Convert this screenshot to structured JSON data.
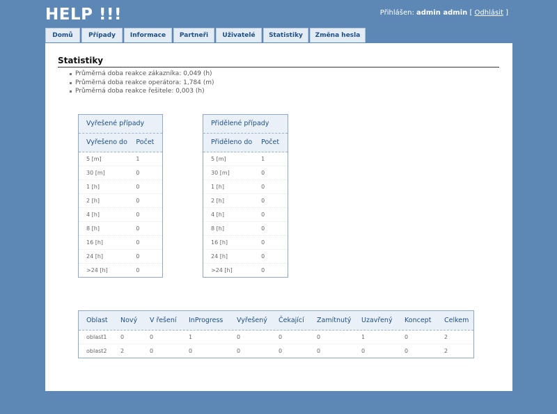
{
  "app": {
    "title": "HELP !!!"
  },
  "user": {
    "prefix": "Přihlášen:",
    "name": "admin admin",
    "open_bracket": "[",
    "logout": "Odhlásit",
    "close_bracket": "]"
  },
  "tabs": [
    "Domů",
    "Případy",
    "Informace",
    "Partneři",
    "Uživatelé",
    "Statistiky",
    "Změna hesla"
  ],
  "page": {
    "heading": "Statistiky"
  },
  "averages": [
    "Průměrná doba reakce zákazníka: 0,049 (h)",
    "Průměrná doba reakce operátora: 1,784 (m)",
    "Průměrná doba reakce řešitele: 0,003 (h)"
  ],
  "resolved": {
    "title": "Vyřešené případy",
    "headers": [
      "Vyřešeno do",
      "Počet"
    ],
    "rows": [
      [
        "5 [m]",
        "1"
      ],
      [
        "30 [m]",
        "0"
      ],
      [
        "1 [h]",
        "0"
      ],
      [
        "2 [h]",
        "0"
      ],
      [
        "4 [h]",
        "0"
      ],
      [
        "8 [h]",
        "0"
      ],
      [
        "16 [h]",
        "0"
      ],
      [
        "24 [h]",
        "0"
      ],
      [
        ">24 [h]",
        "0"
      ]
    ]
  },
  "assigned": {
    "title": "Přidělené případy",
    "headers": [
      "Přiděleno do",
      "Počet"
    ],
    "rows": [
      [
        "5 [m]",
        "1"
      ],
      [
        "30 [m]",
        "0"
      ],
      [
        "1 [h]",
        "0"
      ],
      [
        "2 [h]",
        "0"
      ],
      [
        "4 [h]",
        "0"
      ],
      [
        "8 [h]",
        "0"
      ],
      [
        "16 [h]",
        "0"
      ],
      [
        "24 [h]",
        "0"
      ],
      [
        ">24 [h]",
        "0"
      ]
    ]
  },
  "areas": {
    "headers": [
      "Oblast",
      "Nový",
      "V řešení",
      "InProgress",
      "Vyřešený",
      "Čekající",
      "Zamítnutý",
      "Uzavřený",
      "Koncept",
      "Celkem"
    ],
    "rows": [
      [
        "oblast1",
        "0",
        "0",
        "1",
        "0",
        "0",
        "0",
        "1",
        "0",
        "2"
      ],
      [
        "oblast2",
        "2",
        "0",
        "0",
        "0",
        "0",
        "0",
        "0",
        "0",
        "2"
      ]
    ]
  }
}
